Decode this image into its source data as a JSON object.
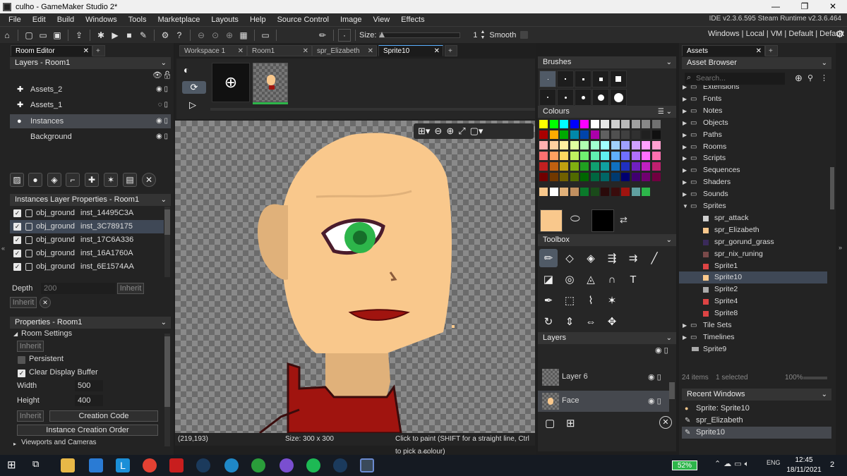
{
  "window": {
    "title": "culho - GameMaker Studio 2*",
    "controls": [
      "—",
      "❐",
      "✕"
    ]
  },
  "menu": [
    "File",
    "Edit",
    "Build",
    "Windows",
    "Tools",
    "Marketplace",
    "Layouts",
    "Help",
    "Source Control",
    "Image",
    "View",
    "Effects"
  ],
  "ide_version": "IDE v2.3.6.595 Steam  Runtime v2.3.6.464",
  "toolbar": {
    "size_label": "Size:",
    "size_value": "1",
    "smooth_label": "Smooth",
    "right_links": "Windows | Local | VM | Default | Default"
  },
  "left": {
    "room_tab": "Room Editor",
    "layers_header": "Layers - Room1",
    "layers": [
      "Assets_2",
      "Assets_1",
      "Instances",
      "Background"
    ],
    "instances_header": "Instances Layer Properties - Room1",
    "instances": [
      {
        "obj": "obj_ground",
        "inst": "inst_14495C3A"
      },
      {
        "obj": "obj_ground",
        "inst": "inst_3C789175"
      },
      {
        "obj": "obj_ground",
        "inst": "inst_17C6A336"
      },
      {
        "obj": "obj_ground",
        "inst": "inst_16A1760A"
      },
      {
        "obj": "obj_ground",
        "inst": "inst_6E1574AA"
      }
    ],
    "depth_label": "Depth",
    "depth_value": "200",
    "inherit": "Inherit",
    "properties_header": "Properties - Room1",
    "room_settings": "Room Settings",
    "persistent": "Persistent",
    "clear_display_buffer": "Clear Display Buffer",
    "width_label": "Width",
    "width_value": "500",
    "height_label": "Height",
    "height_value": "400",
    "creation_code": "Creation Code",
    "instance_creation_order": "Instance Creation Order",
    "viewports": "Viewports and Cameras"
  },
  "center": {
    "tabs": [
      "Workspace 1",
      "Room1",
      "spr_Elizabeth",
      "Sprite10"
    ],
    "status_coords": "(219,193)",
    "status_size": "Size: 300 x 300",
    "status_hint": "Click to paint (SHIFT for a straight line, Ctrl to pick a colour)"
  },
  "brushes_header": "Brushes",
  "colours_header": "Colours",
  "toolbox_header": "Toolbox",
  "layers_right_header": "Layers",
  "sprite_layers": [
    "Layer 6",
    "Face"
  ],
  "assets": {
    "tab": "Assets",
    "header": "Asset Browser",
    "search_placeholder": "Search...",
    "tree": [
      {
        "label": "Extensions",
        "kind": "folder"
      },
      {
        "label": "Fonts",
        "kind": "folder"
      },
      {
        "label": "Notes",
        "kind": "folder"
      },
      {
        "label": "Objects",
        "kind": "folder"
      },
      {
        "label": "Paths",
        "kind": "folder"
      },
      {
        "label": "Rooms",
        "kind": "folder"
      },
      {
        "label": "Scripts",
        "kind": "folder"
      },
      {
        "label": "Sequences",
        "kind": "folder"
      },
      {
        "label": "Shaders",
        "kind": "folder"
      },
      {
        "label": "Sounds",
        "kind": "folder"
      },
      {
        "label": "Sprites",
        "kind": "open"
      },
      {
        "label": "spr_attack",
        "kind": "child"
      },
      {
        "label": "spr_Elizabeth",
        "kind": "child"
      },
      {
        "label": "spr_gorund_grass",
        "kind": "child"
      },
      {
        "label": "spr_nix_runing",
        "kind": "child"
      },
      {
        "label": "Sprite1",
        "kind": "child"
      },
      {
        "label": "Sprite10",
        "kind": "child"
      },
      {
        "label": "Sprite2",
        "kind": "child"
      },
      {
        "label": "Sprite4",
        "kind": "child"
      },
      {
        "label": "Sprite8",
        "kind": "child"
      },
      {
        "label": "Tile Sets",
        "kind": "folder"
      },
      {
        "label": "Timelines",
        "kind": "folder"
      },
      {
        "label": "Sprite9",
        "kind": "root"
      }
    ],
    "count": "24 items",
    "selected": "1 selected",
    "zoom": "100%",
    "recent_header": "Recent Windows",
    "recent": [
      "Sprite: Sprite10",
      "spr_Elizabeth",
      "Sprite10"
    ]
  },
  "taskbar": {
    "battery": "52%",
    "time": "12:45",
    "date": "18/11/2021",
    "notif": "2"
  },
  "colors": {
    "accent_tab": "#5ab0ff",
    "skin": "#f9c88c",
    "eye": "#2db54a",
    "shirt": "#a0140f"
  }
}
